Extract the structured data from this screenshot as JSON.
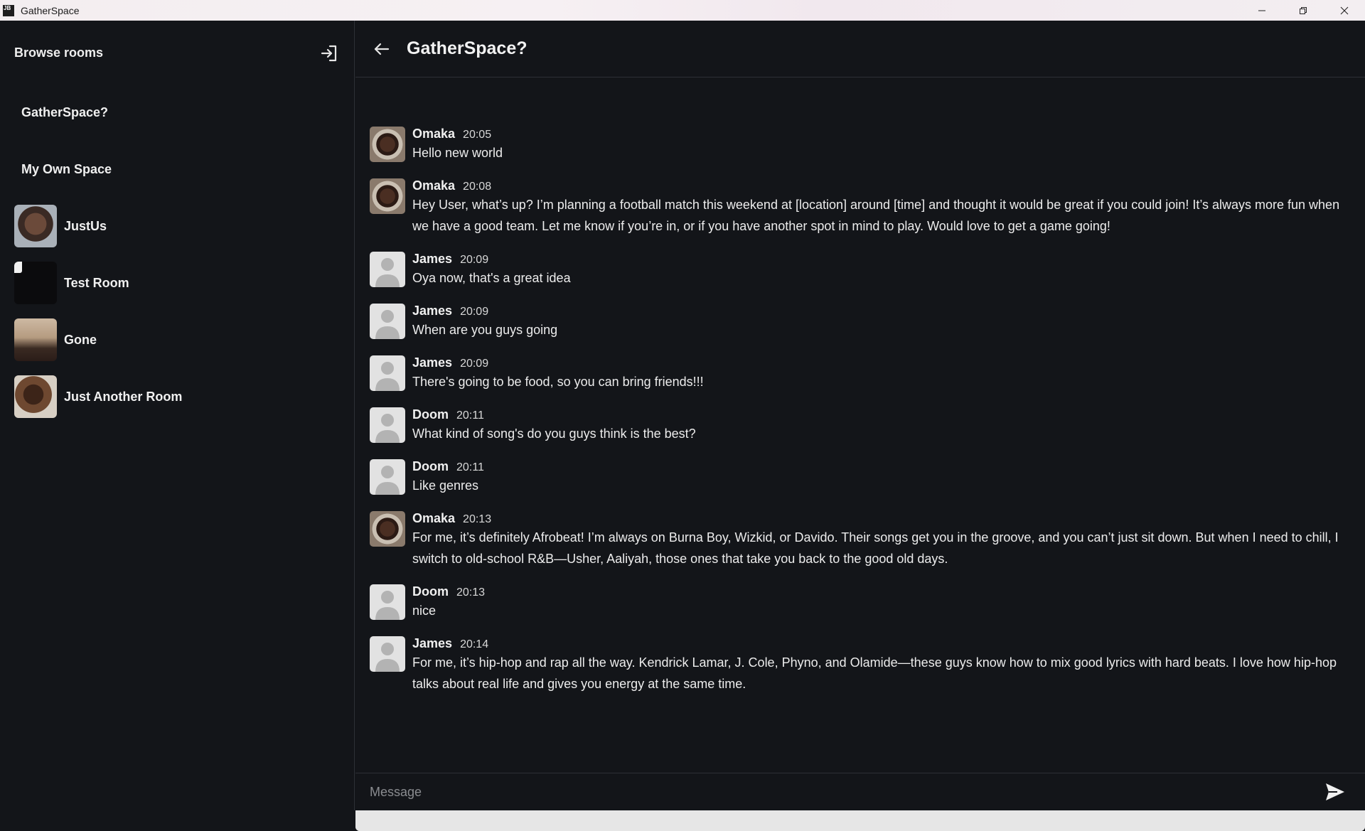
{
  "window": {
    "icon_text": "JB",
    "title": "GatherSpace"
  },
  "sidebar": {
    "title": "Browse rooms",
    "rooms": [
      {
        "name": "GatherSpace?",
        "avatar": "chat-bubbles-icon"
      },
      {
        "name": "My Own Space",
        "avatar": "chat-bubbles-icon"
      },
      {
        "name": "JustUs",
        "avatar": "photo"
      },
      {
        "name": "Test Room",
        "avatar": "dark-image"
      },
      {
        "name": "Gone",
        "avatar": "photo"
      },
      {
        "name": "Just Another Room",
        "avatar": "photo"
      }
    ]
  },
  "chat": {
    "title": "GatherSpace?",
    "messages": [
      {
        "author": "Omaka",
        "time": "20:05",
        "avatar": "photo",
        "text": "Hello new world"
      },
      {
        "author": "Omaka",
        "time": "20:08",
        "avatar": "photo",
        "text": "Hey User, what’s up? I’m planning a football match this weekend at [location] around [time] and thought it would be great if you could join! It’s always more fun when we have a good team. Let me know if you’re in, or if you have another spot in mind to play. Would love to get a game going!"
      },
      {
        "author": "James",
        "time": "20:09",
        "avatar": "default",
        "text": "Oya now, that's a great idea"
      },
      {
        "author": "James",
        "time": "20:09",
        "avatar": "default",
        "text": "When are you guys going"
      },
      {
        "author": "James",
        "time": "20:09",
        "avatar": "default",
        "text": "There's going to be food, so you can bring friends!!!"
      },
      {
        "author": "Doom",
        "time": "20:11",
        "avatar": "default",
        "text": "What kind of song's do you guys think is the best?"
      },
      {
        "author": "Doom",
        "time": "20:11",
        "avatar": "default",
        "text": "Like genres"
      },
      {
        "author": "Omaka",
        "time": "20:13",
        "avatar": "photo",
        "text": "For me, it’s definitely Afrobeat! I’m always on Burna Boy, Wizkid, or Davido. Their songs get you in the groove, and you can’t just sit down. But when I need to chill, I switch to old-school R&B—Usher, Aaliyah, those ones that take you back to the good old days."
      },
      {
        "author": "Doom",
        "time": "20:13",
        "avatar": "default",
        "text": "nice"
      },
      {
        "author": "James",
        "time": "20:14",
        "avatar": "default",
        "text": "For me, it’s hip-hop and rap all the way. Kendrick Lamar, J. Cole, Phyno, and Olamide—these guys know how to mix good lyrics with hard beats. I love how hip-hop talks about real life and gives you energy at the same time."
      }
    ]
  },
  "composer": {
    "placeholder": "Message",
    "value": ""
  },
  "colors": {
    "background": "#131519",
    "divider": "#2d3036",
    "text": "#ececec"
  }
}
